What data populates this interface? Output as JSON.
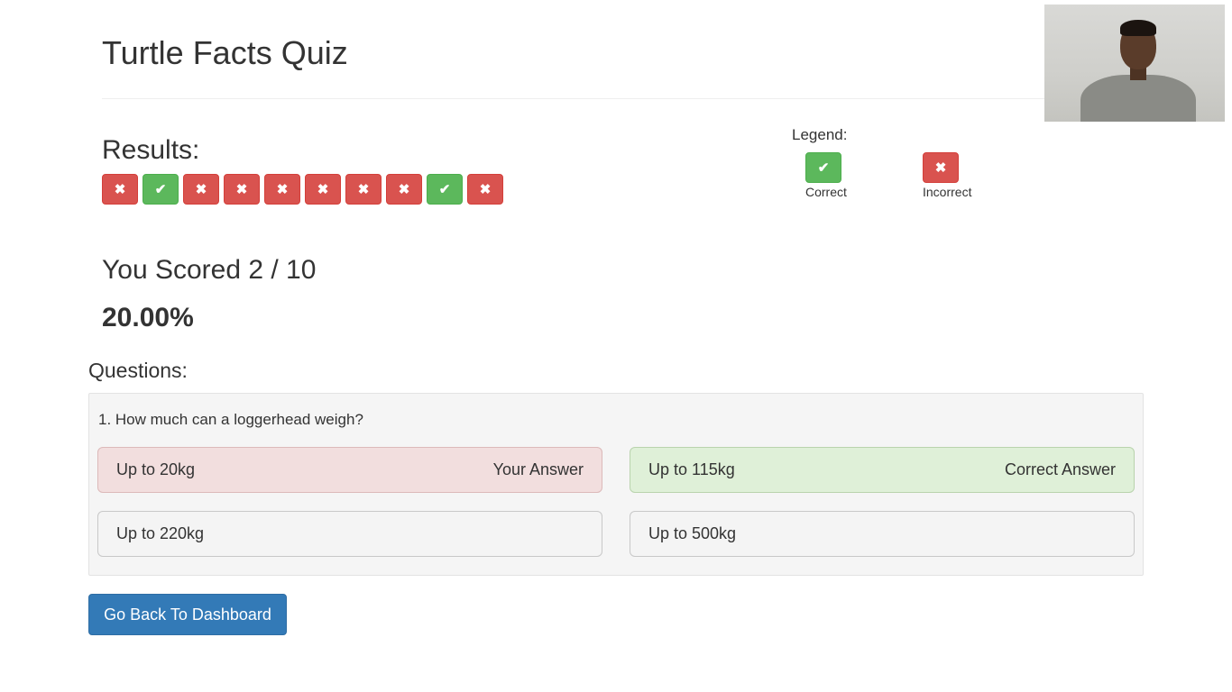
{
  "header": {
    "title": "Turtle Facts Quiz"
  },
  "results": {
    "heading": "Results:",
    "items": [
      {
        "status": "incorrect",
        "icon": "✖"
      },
      {
        "status": "correct",
        "icon": "✔"
      },
      {
        "status": "incorrect",
        "icon": "✖"
      },
      {
        "status": "incorrect",
        "icon": "✖"
      },
      {
        "status": "incorrect",
        "icon": "✖"
      },
      {
        "status": "incorrect",
        "icon": "✖"
      },
      {
        "status": "incorrect",
        "icon": "✖"
      },
      {
        "status": "incorrect",
        "icon": "✖"
      },
      {
        "status": "correct",
        "icon": "✔"
      },
      {
        "status": "incorrect",
        "icon": "✖"
      }
    ]
  },
  "legend": {
    "title": "Legend:",
    "correct_label": "Correct",
    "incorrect_label": "Incorrect",
    "correct_icon": "✔",
    "incorrect_icon": "✖"
  },
  "score": {
    "text": "You Scored 2 / 10",
    "percent": "20.00%"
  },
  "questions": {
    "heading": "Questions:",
    "list": [
      {
        "text": "1. How much can a loggerhead weigh?",
        "answers": [
          {
            "label": "Up to 20kg",
            "tag": "Your Answer",
            "state": "wrong"
          },
          {
            "label": "Up to 115kg",
            "tag": "Correct Answer",
            "state": "right"
          },
          {
            "label": "Up to 220kg",
            "tag": "",
            "state": "neutral"
          },
          {
            "label": "Up to 500kg",
            "tag": "",
            "state": "neutral"
          }
        ]
      }
    ]
  },
  "actions": {
    "back_label": "Go Back To Dashboard"
  },
  "colors": {
    "correct": "#5cb85c",
    "incorrect": "#d9534f",
    "primary": "#337ab7",
    "answer_wrong_bg": "#f2dede",
    "answer_right_bg": "#dff0d8"
  }
}
